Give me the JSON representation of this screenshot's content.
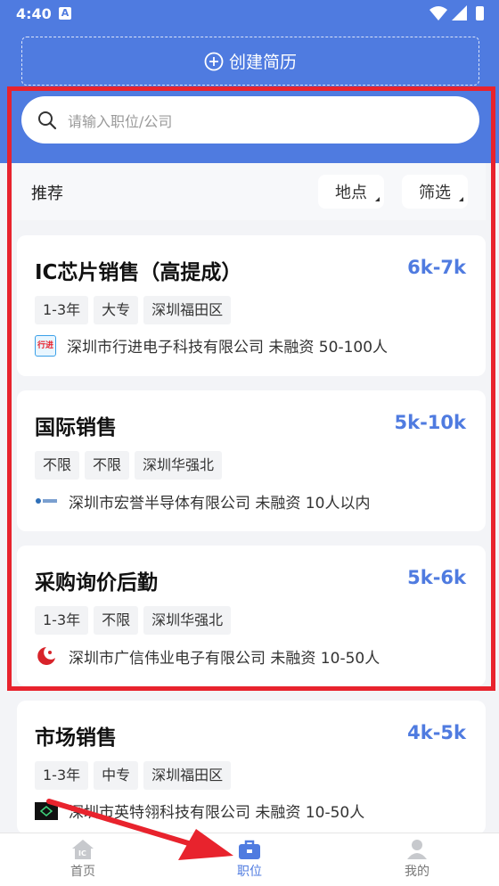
{
  "status": {
    "time": "4:40",
    "a_glyph": "A"
  },
  "header": {
    "create_resume": "创建简历"
  },
  "search": {
    "placeholder": "请输入职位/公司"
  },
  "filters": {
    "recommend": "推荐",
    "location": "地点",
    "filter": "筛选"
  },
  "jobs": [
    {
      "title": "IC芯片销售（高提成）",
      "salary": "6k-7k",
      "tags": [
        "1-3年",
        "大专",
        "深圳福田区"
      ],
      "company": "深圳市行进电子科技有限公司 未融资 50-100人",
      "logo_text": "行进"
    },
    {
      "title": "国际销售",
      "salary": "5k-10k",
      "tags": [
        "不限",
        "不限",
        "深圳华强北"
      ],
      "company": "深圳市宏誉半导体有限公司 未融资 10人以内",
      "logo_text": ""
    },
    {
      "title": "采购询价后勤",
      "salary": "5k-6k",
      "tags": [
        "1-3年",
        "不限",
        "深圳华强北"
      ],
      "company": "深圳市广信伟业电子有限公司 未融资 10-50人",
      "logo_text": ""
    },
    {
      "title": "市场销售",
      "salary": "4k-5k",
      "tags": [
        "1-3年",
        "中专",
        "深圳福田区"
      ],
      "company": "深圳市英特翎科技有限公司 未融资 10-50人",
      "logo_text": ""
    }
  ],
  "nav": [
    {
      "label": "首页",
      "icon": "home-ic-icon"
    },
    {
      "label": "职位",
      "icon": "briefcase-icon"
    },
    {
      "label": "我的",
      "icon": "profile-icon"
    }
  ],
  "colors": {
    "brand": "#4f7be0",
    "highlight": "#e8232d"
  }
}
